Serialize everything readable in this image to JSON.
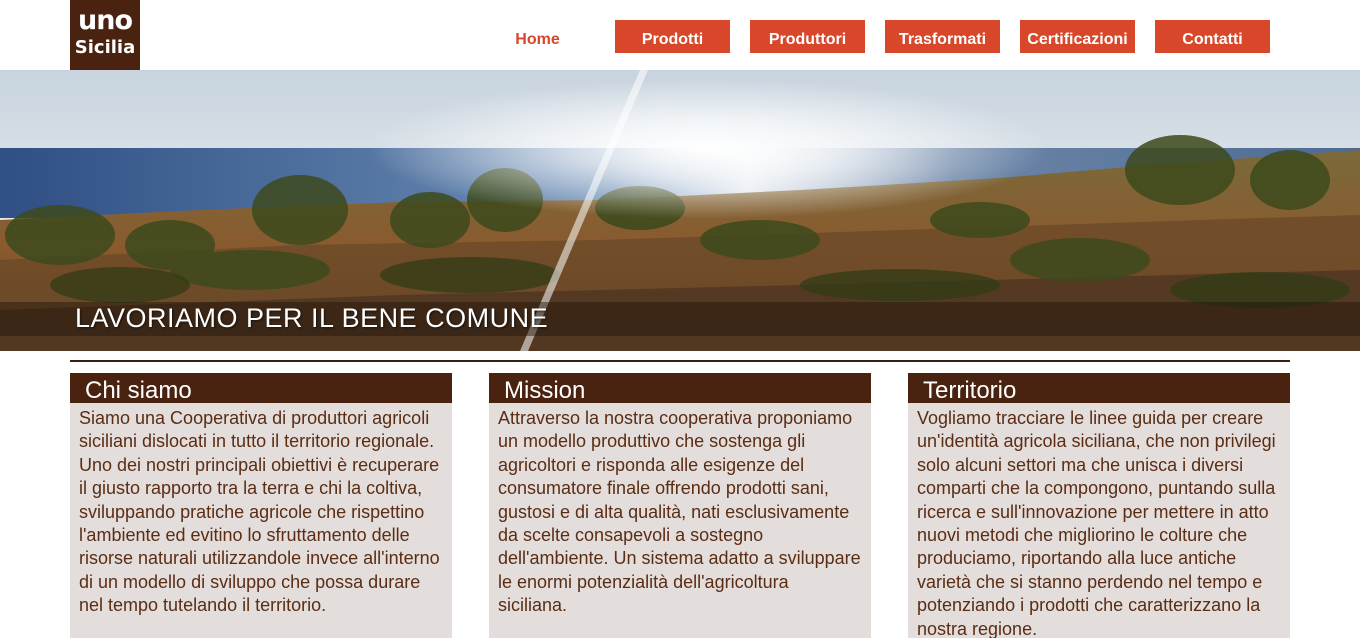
{
  "logo": {
    "line1": "uno",
    "line2": "Sicilia"
  },
  "nav": {
    "home": "Home",
    "items": [
      "Prodotti",
      "Produttori",
      "Trasformati",
      "Certificazioni",
      "Contatti"
    ]
  },
  "hero": {
    "caption": "LAVORIAMO PER IL BENE COMUNE"
  },
  "columns": [
    {
      "title": "Chi siamo",
      "text": "Siamo una Cooperativa di produttori agricoli siciliani dislocati in tutto il territorio regionale. Uno dei nostri principali obiettivi è recuperare il giusto rapporto tra la terra e chi la coltiva, sviluppando pratiche agricole che rispettino l'ambiente ed evitino lo sfruttamento delle risorse naturali utilizzandole invece all'interno di un modello di sviluppo che possa durare nel tempo tutelando il territorio."
    },
    {
      "title": "Mission",
      "text": "Attraverso la nostra cooperativa proponiamo un modello produttivo che sostenga gli agricoltori e risponda alle esigenze del consumatore finale offrendo prodotti sani, gustosi e di alta qualità, nati esclusivamente da scelte consapevoli a sostegno dell'ambiente. Un sistema adatto a sviluppare le enormi potenzialità dell'agricoltura siciliana."
    },
    {
      "title": "Territorio",
      "text": "Vogliamo tracciare le linee guida per creare un'identità agricola siciliana, che non privilegi solo alcuni settori ma che unisca i diversi comparti che la compongono, puntando sulla ricerca e sull'innovazione per mettere in atto nuovi metodi che migliorino le colture che produciamo, riportando alla luce antiche varietà che si stanno perdendo nel tempo e potenziando i prodotti che caratterizzano la nostra regione."
    }
  ],
  "colors": {
    "brand_brown": "#4a2310",
    "accent_red": "#d9472b",
    "panel_bg": "#e3dddb",
    "text_brown": "#5a2d14"
  }
}
